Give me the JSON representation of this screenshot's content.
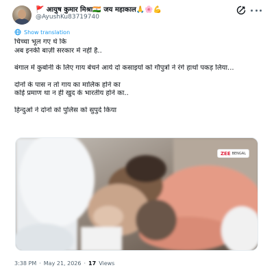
{
  "author": {
    "display_name": "🚩 आयुष कुमार मिश्रा🇮🇳 जय महाकाल🙏🌸💪",
    "handle": "@AyushKu83719740"
  },
  "translate": {
    "label": "Show translation"
  },
  "tweet": {
    "lines": [
      "चिच्चा भूल गए थे कि",
      "अब इनकी बाज़ी सरकार में नहीं है..",
      "",
      "बंगाल में कुर्बानी के लिए गाय बेचने आये दो कसाइयों को गौपुत्रों ने रंगे हाथों पकड़ लिया...",
      "",
      "दोनों के पास न तो गाय का मालिक होने का",
      "कोई प्रमाण था न ही खुद के भारतीय होने का..",
      "",
      "हिन्दुओं ने दोनों को पुलिस को सुपुर्द किया"
    ]
  },
  "media": {
    "description_icon": "video-thumbnail",
    "brand_text": "ZEE",
    "brand_sub": "BENGAL"
  },
  "meta": {
    "time": "3:38 PM",
    "separator": "·",
    "date": "May 21, 2026",
    "views_count": "17",
    "views_label": "Views"
  },
  "icons": {
    "grok": "grok-icon",
    "more": "more-options-icon",
    "translate": "globe-icon"
  },
  "colors": {
    "accent": "#1d9bf0",
    "text": "#0f1419",
    "secondary": "#536471"
  }
}
